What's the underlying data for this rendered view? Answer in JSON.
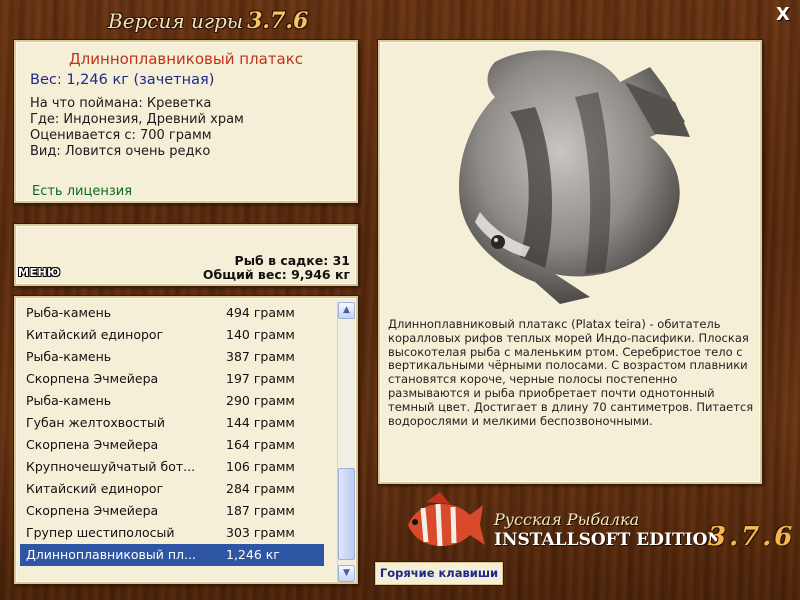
{
  "window": {
    "title": "Версия игры",
    "version": "3.7.6",
    "close_label": "X"
  },
  "fish_info": {
    "name": "Длинноплавниковый платакс",
    "weight": "Вес: 1,246 кг (зачетная)",
    "bait": "На что поймана: Креветка",
    "location": "Где: Индонезия, Древний храм",
    "value": "Оценивается с: 700 грамм",
    "rarity": "Вид: Ловится очень редко",
    "license": "Есть лицензия"
  },
  "keepnet": {
    "count": "Рыб в садке: 31",
    "total": "Общий вес: 9,946 кг",
    "menu_label": "МЕНЮ"
  },
  "catch_list": [
    {
      "name": "Рыба-камень",
      "weight": "494 грамм"
    },
    {
      "name": "Китайский единорог",
      "weight": "140 грамм"
    },
    {
      "name": "Рыба-камень",
      "weight": "387 грамм"
    },
    {
      "name": "Скорпена Эчмейера",
      "weight": "197 грамм"
    },
    {
      "name": "Рыба-камень",
      "weight": "290 грамм"
    },
    {
      "name": "Губан желтохвостый",
      "weight": "144 грамм"
    },
    {
      "name": "Скорпена Эчмейера",
      "weight": "164 грамм"
    },
    {
      "name": "Крупночешуйчатый бот...",
      "weight": "106 грамм"
    },
    {
      "name": "Китайский единорог",
      "weight": "284 грамм"
    },
    {
      "name": "Скорпена Эчмейера",
      "weight": "187 грамм"
    },
    {
      "name": "Групер шестиполосый",
      "weight": "303 грамм"
    },
    {
      "name": "Длинноплавниковый пл...",
      "weight": "1,246 кг",
      "selected": true
    }
  ],
  "description": "Длинноплавниковый платакс (Platax teira) - обитатель коралловых рифов теплых морей Индо-пасифики. Плоская высокотелая рыба с маленьким ртом. Серебристое тело с вертикальными чёрными полосами. С возрастом плавники становятся короче, черные полосы постепенно размываются и рыба приобретает почти однотонный темный цвет. Достигает в длину 70 сантиметров. Питается водорослями и мелкими беспозвоночными.",
  "branding": {
    "line1": "Русская Рыбалка",
    "line2": "INSTALLSOFT EDITION",
    "version": "3.7.6"
  },
  "hotkeys_label": "Горячие клавиши"
}
